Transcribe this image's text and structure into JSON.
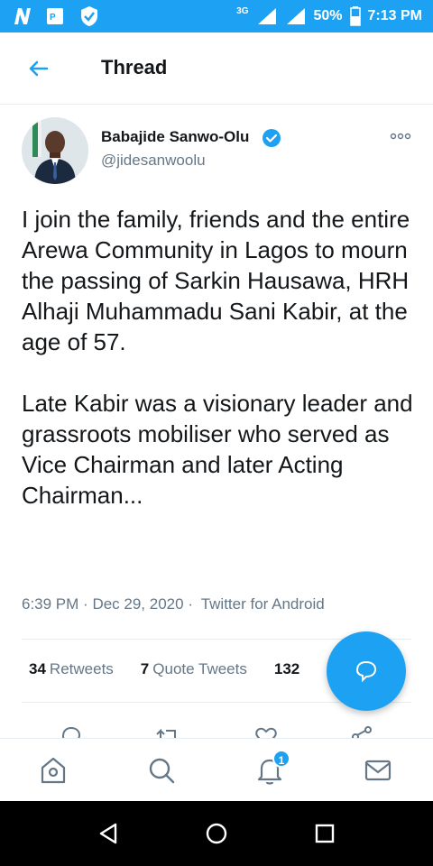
{
  "status": {
    "network": "3G",
    "battery": "50%",
    "time": "7:13 PM"
  },
  "header": {
    "title": "Thread"
  },
  "tweet": {
    "author": "Babajide Sanwo-Olu",
    "handle": "@jidesanwoolu",
    "text": "I join the family, friends and the entire Arewa Community in Lagos to mourn the passing of Sarkin Hausawa, HRH Alhaji Muhammadu Sani Kabir, at the age of 57.\n\nLate Kabir was a visionary leader and grassroots mobiliser who served as Vice Chairman and later Acting Chairman...",
    "time": "6:39 PM",
    "date": "Dec 29, 2020",
    "source": "Twitter for Android",
    "retweets_count": "34",
    "retweets_label": "Retweets",
    "quotes_count": "7",
    "quotes_label": "Quote Tweets",
    "likes_count": "132"
  },
  "nav": {
    "notifications_badge": "1"
  },
  "colors": {
    "brand": "#1da1f2",
    "text": "#14171a",
    "muted": "#657786"
  }
}
